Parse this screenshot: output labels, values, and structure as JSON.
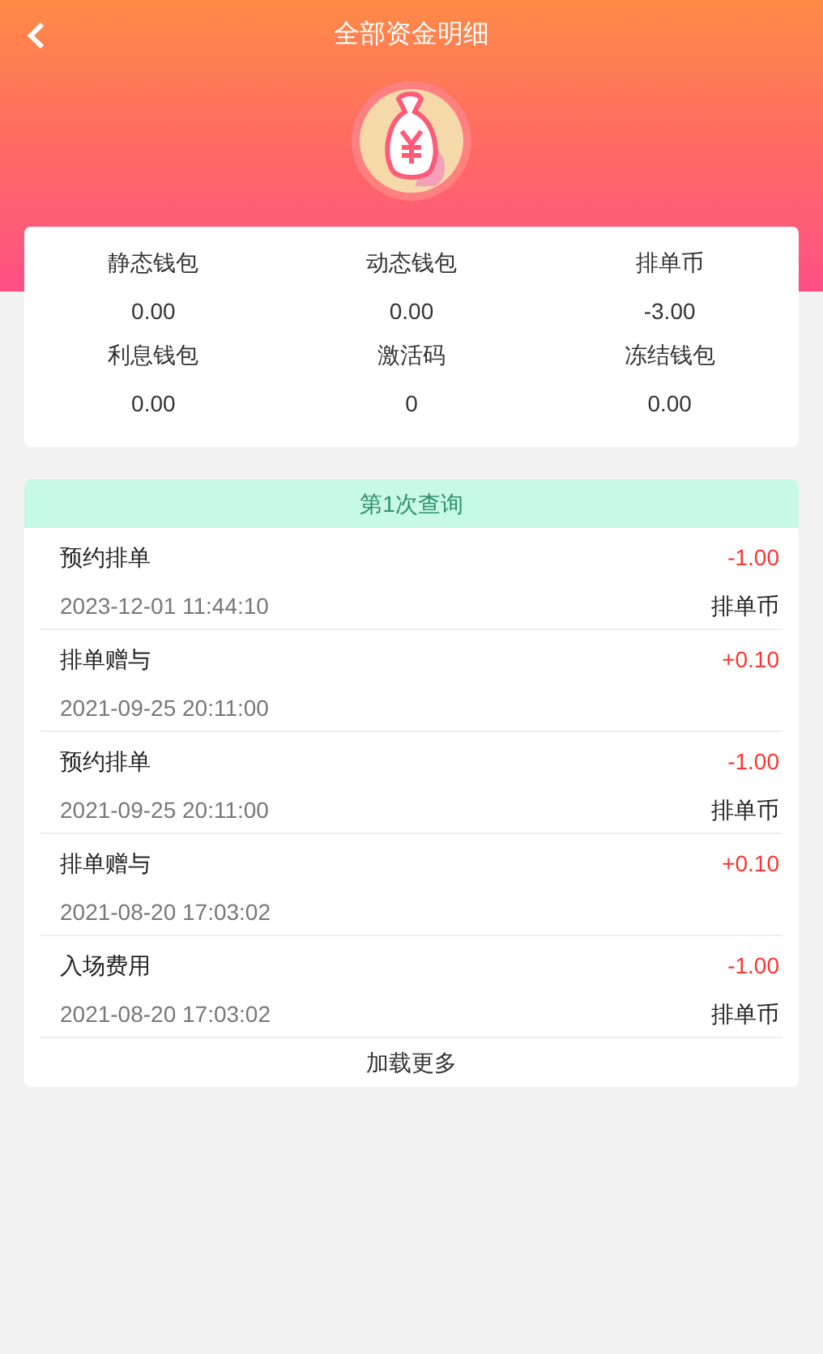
{
  "header": {
    "title": "全部资金明细"
  },
  "wallets": [
    {
      "label": "静态钱包",
      "value": "0.00"
    },
    {
      "label": "动态钱包",
      "value": "0.00"
    },
    {
      "label": "排单币",
      "value": "-3.00"
    },
    {
      "label": "利息钱包",
      "value": "0.00"
    },
    {
      "label": "激活码",
      "value": "0"
    },
    {
      "label": "冻结钱包",
      "value": "0.00"
    }
  ],
  "query": {
    "title": "第1次查询"
  },
  "records": [
    {
      "name": "预约排单",
      "time": "2023-12-01 11:44:10",
      "amount": "-1.00",
      "unit": "排单币"
    },
    {
      "name": "排单赠与",
      "time": "2021-09-25 20:11:00",
      "amount": "+0.10"
    },
    {
      "name": "预约排单",
      "time": "2021-09-25 20:11:00",
      "amount": "-1.00",
      "unit": "排单币"
    },
    {
      "name": "排单赠与",
      "time": "2021-08-20 17:03:02",
      "amount": "+0.10"
    },
    {
      "name": "入场费用",
      "time": "2021-08-20 17:03:02",
      "amount": "-1.00",
      "unit": "排单币"
    }
  ],
  "load_more": "加载更多"
}
